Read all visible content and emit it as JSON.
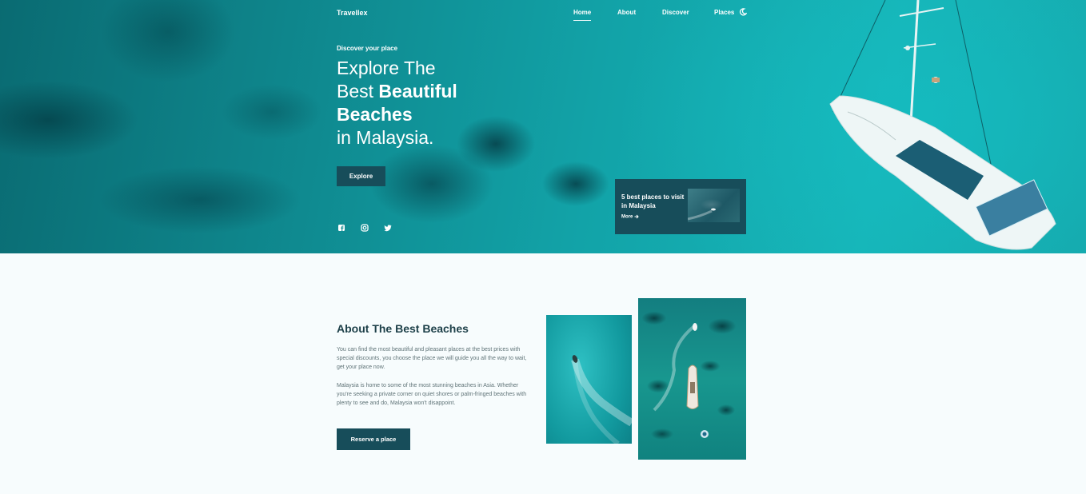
{
  "nav": {
    "logo": "Travellex",
    "links": [
      "Home",
      "About",
      "Discover",
      "Places"
    ],
    "active": "Home"
  },
  "hero": {
    "subtitle": "Discover your place",
    "title_line1": "Explore The",
    "title_line2_regular": "Best ",
    "title_line2_bold": "Beautiful",
    "title_line3_bold": "Beaches",
    "title_line4": "in Malaysia.",
    "cta_label": "Explore",
    "social_icons": [
      "facebook-icon",
      "instagram-icon",
      "twitter-icon"
    ]
  },
  "promo": {
    "title": "5 best places to visit in Malaysia",
    "more_label": "More",
    "more_icon": "arrow-right-icon"
  },
  "about": {
    "title": "About The Best Beaches",
    "paragraph1": "You can find the most beautiful and pleasant places at the best prices with special discounts, you choose the place we will guide you all the way to wait, get your place now.",
    "paragraph2": "Malaysia is home to some of the most stunning beaches in Asia. Whether you're seeking a private corner on quiet shores or palm-fringed beaches with plenty to see and do, Malaysia won't disappoint.",
    "cta_label": "Reserve a place"
  },
  "colors": {
    "primary": "#174d5a",
    "heading": "#1c3f48",
    "text": "#5f7377",
    "background": "#f7fcfd"
  }
}
